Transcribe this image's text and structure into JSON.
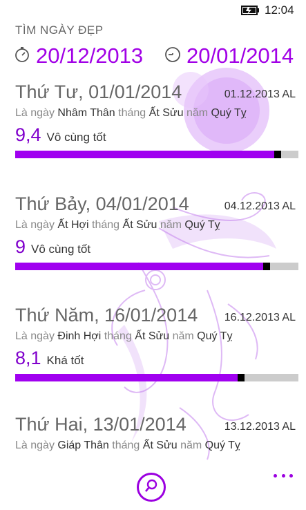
{
  "status_bar": {
    "time": "12:04",
    "battery_icon": "battery-charging-icon"
  },
  "app": {
    "title": "TÌM NGÀY ĐẸP",
    "accent_color": "#a100e6"
  },
  "date_range": {
    "from": {
      "icon": "stopwatch-icon",
      "value": "20/12/2013"
    },
    "to": {
      "icon": "clock-icon",
      "value": "20/01/2014"
    }
  },
  "labels": {
    "day_prefix": "Là ngày",
    "month_word": "tháng",
    "year_word": "năm"
  },
  "results": [
    {
      "day": "Thứ Tư, 01/01/2014",
      "lunar": "01.12.2013 AL",
      "day_cc": "Nhâm Thân",
      "month_cc": "Ất Sửu",
      "year_cc": "Quý Tỵ",
      "score": "9,4",
      "rating": "Vô cùng tốt",
      "score_value": 9.4
    },
    {
      "day": "Thứ Bảy, 04/01/2014",
      "lunar": "04.12.2013 AL",
      "day_cc": "Ất Hợi",
      "month_cc": "Ất Sửu",
      "year_cc": "Quý Tỵ",
      "score": "9",
      "rating": "Vô cùng tốt",
      "score_value": 9.0
    },
    {
      "day": "Thứ Năm, 16/01/2014",
      "lunar": "16.12.2013 AL",
      "day_cc": "Đinh Hợi",
      "month_cc": "Ất Sửu",
      "year_cc": "Quý Tỵ",
      "score": "8,1",
      "rating": "Khá tốt",
      "score_value": 8.1
    },
    {
      "day": "Thứ Hai, 13/01/2014",
      "lunar": "13.12.2013 AL",
      "day_cc": "Giáp Thân",
      "month_cc": "Ất Sửu",
      "year_cc": "Quý Tỵ"
    }
  ],
  "app_bar": {
    "search_icon": "search-icon",
    "more_icon": "ellipsis-icon"
  }
}
